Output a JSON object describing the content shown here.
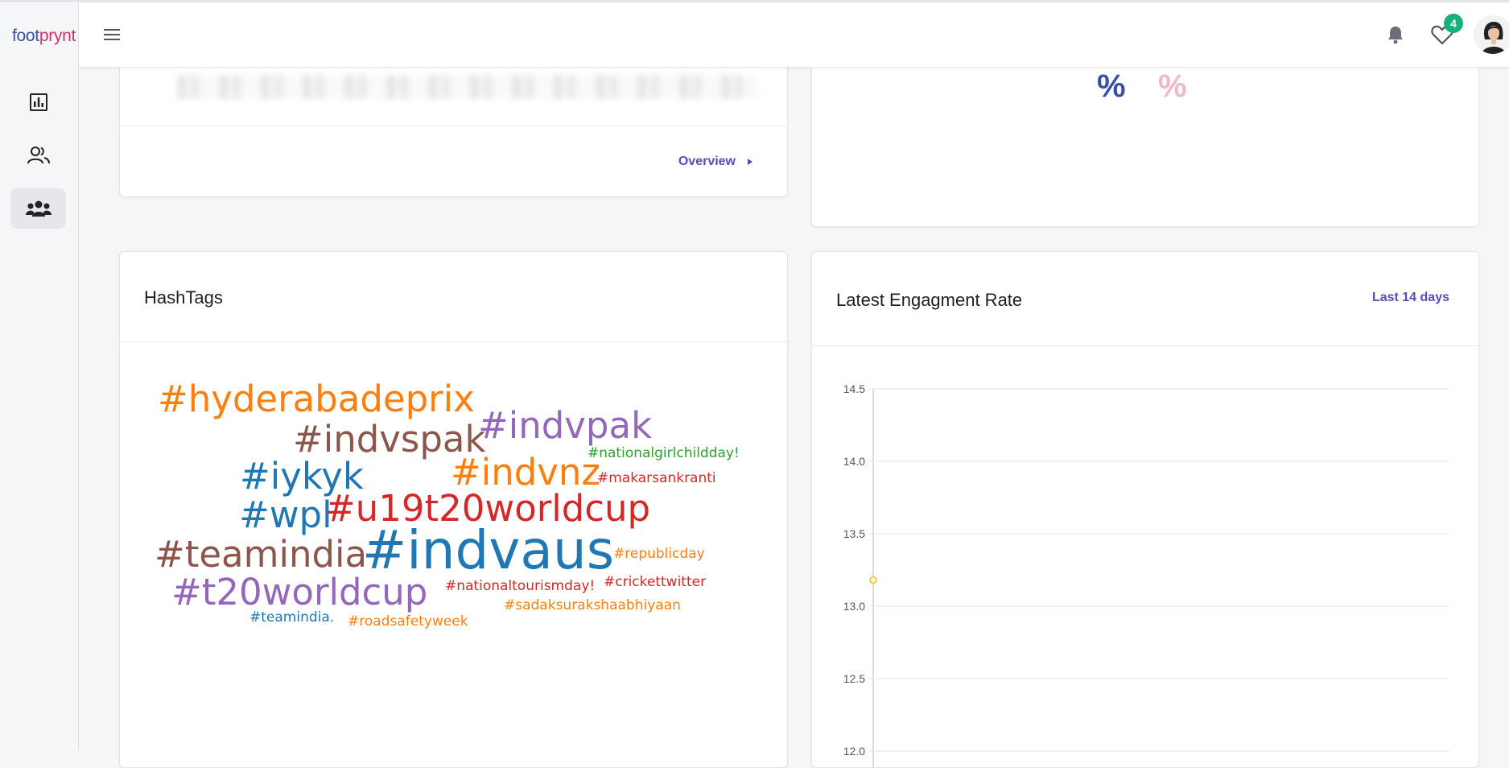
{
  "brand": {
    "logo_part1": "foot",
    "logo_part2": "prynt"
  },
  "sidebar": {
    "items": [
      {
        "name": "analytics",
        "icon": "bar-chart-icon"
      },
      {
        "name": "users",
        "icon": "users-icon"
      },
      {
        "name": "groups",
        "icon": "group-icon",
        "active": true
      }
    ]
  },
  "header": {
    "notification_badge": "4",
    "icons": [
      "menu-icon",
      "bell-icon",
      "heart-icon",
      "avatar"
    ]
  },
  "top_left_card": {
    "link_label": "Overview"
  },
  "top_right_card": {
    "percent_a": "%",
    "percent_b": "%",
    "colors": {
      "a": "#3b4fa8",
      "b": "#f2b8c8"
    }
  },
  "hashtags_card": {
    "title": "HashTags",
    "words": [
      {
        "text": "#hyderabadeprix",
        "color": "#ff7f0e"
      },
      {
        "text": "#indvspak",
        "color": "#8c564b"
      },
      {
        "text": "#indvpak",
        "color": "#9467bd"
      },
      {
        "text": "#nationalgirlchildday!",
        "color": "#2ca02c"
      },
      {
        "text": "#iykyk",
        "color": "#1f77b4"
      },
      {
        "text": "#indvnz",
        "color": "#ff7f0e"
      },
      {
        "text": "#makarsankranti",
        "color": "#d62728"
      },
      {
        "text": "#wpl",
        "color": "#1f77b4"
      },
      {
        "text": "#u19t20worldcup",
        "color": "#d62728"
      },
      {
        "text": "#teamindia",
        "color": "#8c564b"
      },
      {
        "text": "#indvaus",
        "color": "#1f77b4"
      },
      {
        "text": "#republicday",
        "color": "#ff7f0e"
      },
      {
        "text": "#t20worldcup",
        "color": "#9467bd"
      },
      {
        "text": "#nationaltourismday!",
        "color": "#d62728"
      },
      {
        "text": "#crickettwitter",
        "color": "#d62728"
      },
      {
        "text": "#sadaksurakshaabhiyaan",
        "color": "#ff7f0e"
      },
      {
        "text": "#teamindia.",
        "color": "#1f77b4"
      },
      {
        "text": "#roadsafetyweek",
        "color": "#ff7f0e"
      }
    ]
  },
  "engagement_card": {
    "title": "Latest Engagment Rate",
    "range_label": "Last 14 days"
  },
  "chart_data": {
    "type": "line",
    "title": "",
    "xlabel": "",
    "ylabel": "",
    "ylim": [
      12.0,
      14.5
    ],
    "yticks": [
      "14.5",
      "14.0",
      "13.5",
      "13.0",
      "12.5",
      "12.0"
    ],
    "grid": true,
    "series": [
      {
        "values": [
          13.18
        ],
        "color": "#f0c040"
      }
    ]
  }
}
